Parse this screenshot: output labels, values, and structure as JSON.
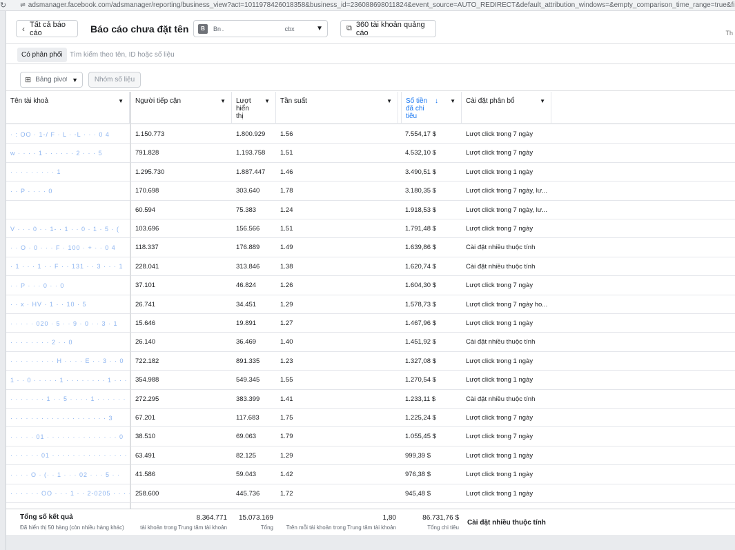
{
  "browser": {
    "url": "adsmanager.facebook.com/adsmanager/reporting/business_view?act=1011978426018358&business_id=236088698011824&event_source=AUTO_REDIRECT&default_attribution_windows=&empty_comparison_time_range=true&filter_set=had_deli"
  },
  "header": {
    "back_label": "Tất cả báo cáo",
    "title": "Báo cáo chưa đặt tên",
    "account_initial": "B",
    "account_name": "Bn .                                                 cbx",
    "accounts_label": "360 tài khoản quảng cáo",
    "edge_char": "Th"
  },
  "filter": {
    "chip_label": "Có phân phối",
    "search_placeholder": "Tìm kiếm theo tên, ID hoặc số liệu"
  },
  "toolbar": {
    "pivot_label": "Bảng pivot",
    "group_label": "Nhóm số liệu"
  },
  "columns": {
    "account": "Tên tài khoả",
    "reach": "Người tiếp cận",
    "impressions": "Lượt hiển thị",
    "frequency": "Tần suất",
    "spend": "Số tiền đã chi tiêu",
    "attribution": "Cài đặt phân bổ"
  },
  "rows": [
    {
      "name": "· : OO · 1-/ F · L · -L · · · 0 4",
      "reach": "1.150.773",
      "impr": "1.800.929",
      "freq": "1.56",
      "spend": "7.554,17 $",
      "attr": "Lượt click trong 7 ngày"
    },
    {
      "name": "w · · · · 1 · · · · · · 2 · · · 5",
      "reach": "791.828",
      "impr": "1.193.758",
      "freq": "1.51",
      "spend": "4.532,10 $",
      "attr": "Lượt click trong 7 ngày"
    },
    {
      "name": "· · · · · · · · · 1",
      "reach": "1.295.730",
      "impr": "1.887.447",
      "freq": "1.46",
      "spend": "3.490,51 $",
      "attr": "Lượt click trong 1 ngày"
    },
    {
      "name": "· · P · · · · 0",
      "reach": "170.698",
      "impr": "303.640",
      "freq": "1.78",
      "spend": "3.180,35 $",
      "attr": "Lượt click trong 7 ngày, lư..."
    },
    {
      "name": "",
      "reach": "60.594",
      "impr": "75.383",
      "freq": "1.24",
      "spend": "1.918,53 $",
      "attr": "Lượt click trong 7 ngày, lư..."
    },
    {
      "name": "V · · · 0 · · 1- · 1 · · 0 · 1 · 5 · (",
      "reach": "103.696",
      "impr": "156.566",
      "freq": "1.51",
      "spend": "1.791,48 $",
      "attr": "Lượt click trong 7 ngày"
    },
    {
      "name": "· · O · 0 · · · F · 100 · + · · 0 4",
      "reach": "118.337",
      "impr": "176.889",
      "freq": "1.49",
      "spend": "1.639,86 $",
      "attr": "Cài đặt nhiều thuộc tính"
    },
    {
      "name": "· 1 · · · 1 · · F · · 131 · · 3 · · · 1",
      "reach": "228.041",
      "impr": "313.846",
      "freq": "1.38",
      "spend": "1.620,74 $",
      "attr": "Cài đặt nhiều thuộc tính"
    },
    {
      "name": "· · P · · · 0 · · 0",
      "reach": "37.101",
      "impr": "46.824",
      "freq": "1.26",
      "spend": "1.604,30 $",
      "attr": "Lượt click trong 7 ngày"
    },
    {
      "name": "· · x · HV · 1 · · 10 · 5",
      "reach": "26.741",
      "impr": "34.451",
      "freq": "1.29",
      "spend": "1.578,73 $",
      "attr": "Lượt click trong 7 ngày ho..."
    },
    {
      "name": "· · · · · 020 · 5 · · 9 · 0 · · 3 · 1",
      "reach": "15.646",
      "impr": "19.891",
      "freq": "1.27",
      "spend": "1.467,96 $",
      "attr": "Lượt click trong 1 ngày"
    },
    {
      "name": "· · · · · · · · 2 · · 0",
      "reach": "26.140",
      "impr": "36.469",
      "freq": "1.40",
      "spend": "1.451,92 $",
      "attr": "Cài đặt nhiều thuộc tính"
    },
    {
      "name": "· · · · · · · · · H · · · · E · · 3 · · 0",
      "reach": "722.182",
      "impr": "891.335",
      "freq": "1.23",
      "spend": "1.327,08 $",
      "attr": "Lượt click trong 1 ngày"
    },
    {
      "name": "1 · · 0 · · · · · 1 · · · · · · · · 1 · · · 0",
      "reach": "354.988",
      "impr": "549.345",
      "freq": "1.55",
      "spend": "1.270,54 $",
      "attr": "Lượt click trong 1 ngày"
    },
    {
      "name": "· · · · · · · 1 · · 5 · · · · 1 · · · · · ·",
      "reach": "272.295",
      "impr": "383.399",
      "freq": "1.41",
      "spend": "1.233,11 $",
      "attr": "Cài đặt nhiều thuộc tính"
    },
    {
      "name": "· · · · · · · · · · · · · · · · · · · 3",
      "reach": "67.201",
      "impr": "117.683",
      "freq": "1.75",
      "spend": "1.225,24 $",
      "attr": "Lượt click trong 7 ngày"
    },
    {
      "name": "· · · · · 01 · · · · · · · · · · · · · · 0",
      "reach": "38.510",
      "impr": "69.063",
      "freq": "1.79",
      "spend": "1.055,45 $",
      "attr": "Lượt click trong 7 ngày"
    },
    {
      "name": "· · · · · · 01 · · · · · · · · · · · · · · · (",
      "reach": "63.491",
      "impr": "82.125",
      "freq": "1.29",
      "spend": "999,39 $",
      "attr": "Lượt click trong 1 ngày"
    },
    {
      "name": "· · · · O · (· · 1 · · · 02 · · · 5 · ·",
      "reach": "41.586",
      "impr": "59.043",
      "freq": "1.42",
      "spend": "976,38 $",
      "attr": "Lượt click trong 1 ngày"
    },
    {
      "name": "· · · · · · OO · · · 1 · · 2-0205 · · · · · ·",
      "reach": "258.600",
      "impr": "445.736",
      "freq": "1.72",
      "spend": "945,48 $",
      "attr": "Lượt click trong 1 ngày"
    }
  ],
  "footer": {
    "title": "Tổng số kết quả",
    "subtitle": "Đã hiển thị 50 hàng (còn nhiều hàng khác)",
    "reach": "8.364.771",
    "reach_caption": "tài khoản trong Trung tâm tài khoản",
    "impressions": "15.073.169",
    "impressions_caption": "Tổng",
    "frequency": "1,80",
    "frequency_caption": "Trên mỗi tài khoản trong Trung tâm tài khoản",
    "spend": "86.731,76 $",
    "spend_caption": "Tổng chi tiêu",
    "attribution": "Cài đặt nhiều thuộc tính"
  }
}
